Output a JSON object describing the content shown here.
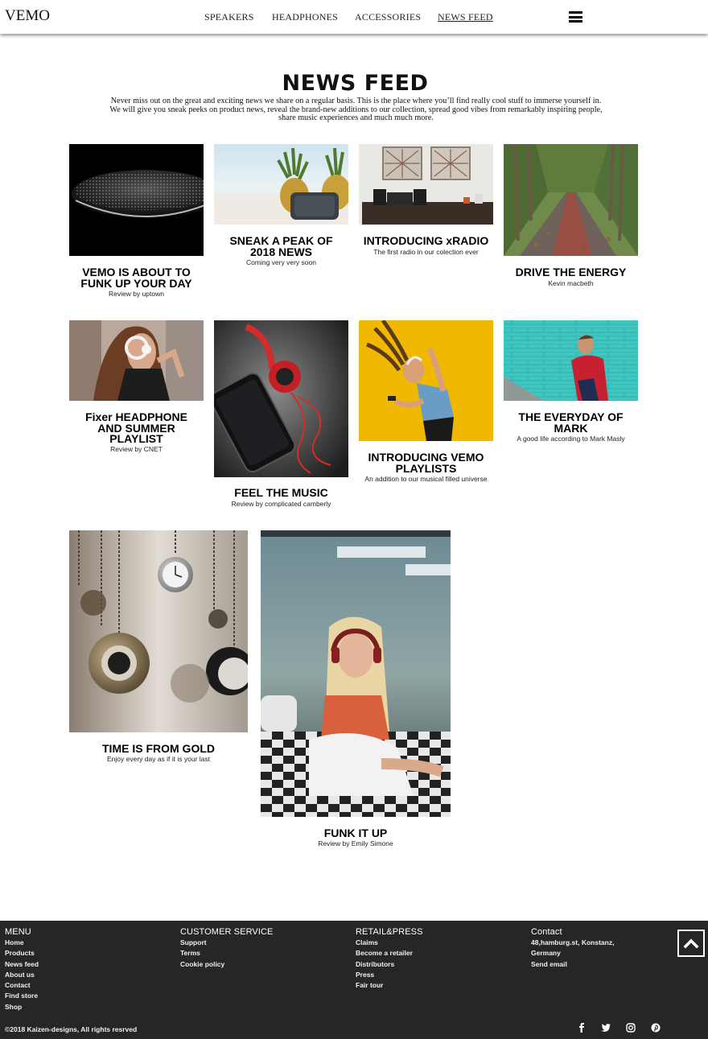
{
  "header": {
    "logo": "VEMO",
    "nav": [
      "SPEAKERS",
      "HEADPHONES",
      "ACCESSORIES",
      "NEWS FEED"
    ]
  },
  "page": {
    "title": "NEWS FEED",
    "intro_lines": [
      "Never miss out on the great and exciting news we share on a regular basis. This is the place where you’ll find really cool stuff to immerse yourself in.",
      "We will give you sneak peeks on product news, reveal the brand-new additions to our collection, spread good vibes from remarkably inspiring people,",
      "share music experiences and much much more."
    ]
  },
  "cards": [
    {
      "title": [
        "VEMO IS ABOUT TO",
        "FUNK UP YOUR DAY"
      ],
      "subtitle": "Review by uptown"
    },
    {
      "title": [
        "SNEAK A PEAK OF",
        "2018 NEWS"
      ],
      "subtitle": "Coming very very soon"
    },
    {
      "title": [
        "INTRODUCING xRADIO"
      ],
      "subtitle": "The first radio in our colection ever"
    },
    {
      "title": [
        "DRIVE THE ENERGY"
      ],
      "subtitle": "Kevin macbeth"
    },
    {
      "title": [
        "Fixer HEADPHONE",
        "AND SUMMER",
        "PLAYLIST"
      ],
      "subtitle": "Review by CNET"
    },
    {
      "title": [
        "FEEL THE MUSIC"
      ],
      "subtitle": "Review by complicated camberly"
    },
    {
      "title": [
        "INTRODUCING VEMO",
        "PLAYLISTS"
      ],
      "subtitle": "An addition to our musical filled universe"
    },
    {
      "title": [
        "THE EVERYDAY OF",
        "MARK"
      ],
      "subtitle": "A good life according to Mark Masly"
    },
    {
      "title": [
        "TIME IS FROM GOLD"
      ],
      "subtitle": "Enjoy every day as if it is your last"
    },
    {
      "title": [
        "FUNK IT UP"
      ],
      "subtitle": "Review by Emily Simone"
    }
  ],
  "footer": {
    "menu": {
      "heading": "MENU",
      "links": [
        "Home",
        "Products",
        "News feed",
        "About us",
        "Contact",
        "Find store",
        "Shop"
      ]
    },
    "customer_service": {
      "heading": "CUSTOMER SERVICE",
      "links": [
        "Support",
        "Terms",
        "Cookie policy"
      ]
    },
    "retail": {
      "heading": "RETAIL&PRESS",
      "links": [
        "Claims",
        "Become a retailer",
        "Distributors",
        "Press",
        "Fair tour"
      ]
    },
    "contact": {
      "heading": "Contact",
      "lines": [
        "48,hamburg.st, Konstanz,",
        "Germany"
      ],
      "email_link": "Send email"
    },
    "copyright": "©2018 Kaizen-designs, All rights resrved",
    "social": [
      "facebook-icon",
      "twitter-icon",
      "instagram-icon",
      "pinterest-icon"
    ]
  },
  "colors": {
    "footer_bg": "#262626",
    "text": "#111111",
    "page_bg": "#ffffff"
  }
}
